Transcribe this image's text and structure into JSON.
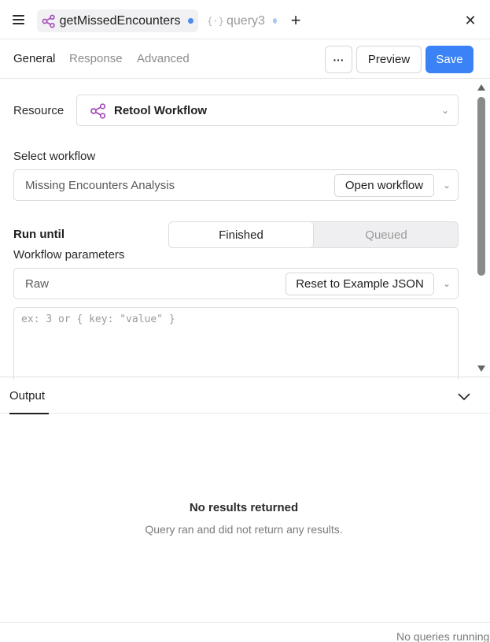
{
  "tabs": [
    {
      "label": "getMissedEncounters",
      "active": true,
      "dot_color": "#4a8cf0",
      "icon": "workflow-icon"
    },
    {
      "label": "query3",
      "active": false,
      "dot_color": "#a9c8f5",
      "icon": "braces-icon"
    }
  ],
  "colors": {
    "accent": "#3b82f6",
    "workflow_purple": "#a34bb8"
  },
  "subtabs": {
    "general": "General",
    "response": "Response",
    "advanced": "Advanced"
  },
  "toolbar": {
    "more_label": "···",
    "preview_label": "Preview",
    "save_label": "Save"
  },
  "resource": {
    "label": "Resource",
    "value": "Retool Workflow"
  },
  "workflow": {
    "label": "Select workflow",
    "value": "Missing Encounters Analysis",
    "open_label": "Open workflow"
  },
  "run_until": {
    "label": "Run until",
    "options": [
      "Finished",
      "Queued"
    ],
    "selected": "Finished"
  },
  "params": {
    "label": "Workflow parameters",
    "mode": "Raw",
    "reset_label": "Reset to Example JSON",
    "placeholder": "ex: 3 or { key: \"value\" }"
  },
  "output": {
    "tab_label": "Output",
    "empty_title": "No results returned",
    "empty_subtitle": "Query ran and did not return any results."
  },
  "footer": {
    "status": "No queries running"
  }
}
